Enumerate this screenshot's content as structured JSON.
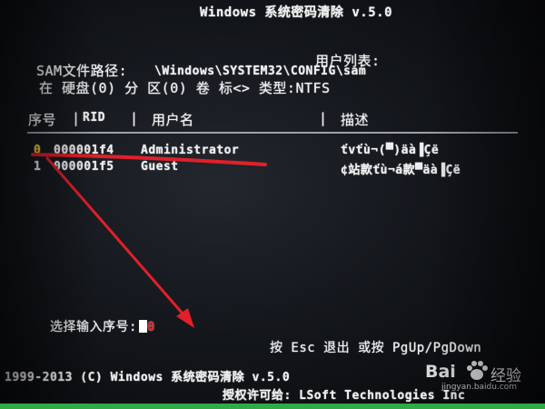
{
  "screen": {
    "title": "Windows 系统密码清除 v.5.0",
    "user_list_label": "用户列表:",
    "sam_path_label": "SAM文件路径:",
    "sam_path_value": "\\Windows\\SYSTEM32\\CONFIG\\sam",
    "location": "在 硬盘(0) 分 区(0) 卷 标<> 类型:NTFS"
  },
  "table": {
    "columns": [
      "序号",
      "RID",
      "用户名",
      "描述"
    ],
    "rows": [
      {
        "index": "0",
        "rid": "000001f4",
        "name": "Administrator",
        "description": "ťvťù¬(▀)äà▐Çë"
      },
      {
        "index": "1",
        "rid": "000001f5",
        "name": "Guest",
        "description": "¢站款ťù¬á款▀äà▐Çë"
      }
    ]
  },
  "prompt": {
    "label": "选择输入序号:",
    "value": "0"
  },
  "hint": "按 Esc 退出  或按 PgUp/PgDown",
  "footer": {
    "copyright": "1999-2013 (C) Windows 系统密码清除 v.5.0",
    "license": "授权许可给: LSoft Technologies Inc"
  },
  "watermark": {
    "brand": "Bai",
    "word": "经验",
    "url": "jingyan.baidu.com"
  },
  "colors": {
    "annotation": "#e0202a",
    "highlight_index": "#f0c418",
    "bottom_bar": "#2faa45"
  }
}
